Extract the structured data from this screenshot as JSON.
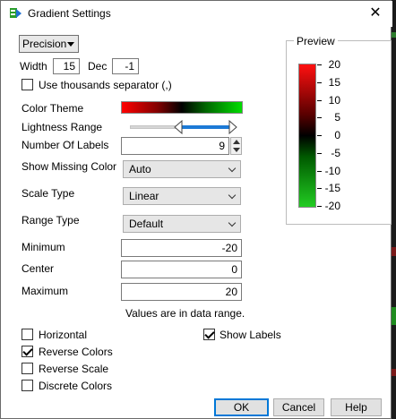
{
  "window": {
    "title": "Gradient Settings"
  },
  "format": {
    "precision_label": "Precision",
    "width_label": "Width",
    "width_value": "15",
    "dec_label": "Dec",
    "dec_value": "-1",
    "thousands_label": "Use thousands separator (,)",
    "thousands_checked": false
  },
  "settings": {
    "color_theme_label": "Color Theme",
    "lightness_range_label": "Lightness Range",
    "number_of_labels_label": "Number Of Labels",
    "number_of_labels_value": "9",
    "show_missing_color_label": "Show Missing Color",
    "show_missing_color_value": "Auto",
    "scale_type_label": "Scale Type",
    "scale_type_value": "Linear",
    "range_type_label": "Range Type",
    "range_type_value": "Default",
    "minimum_label": "Minimum",
    "minimum_value": "-20",
    "center_label": "Center",
    "center_value": "0",
    "maximum_label": "Maximum",
    "maximum_value": "20",
    "range_note": "Values are in data range."
  },
  "preview": {
    "label": "Preview",
    "tick_labels": [
      "20",
      "15",
      "10",
      "5",
      "0",
      "-5",
      "-10",
      "-15",
      "-20"
    ]
  },
  "options": {
    "horizontal_label": "Horizontal",
    "horizontal_checked": false,
    "reverse_colors_label": "Reverse Colors",
    "reverse_colors_checked": true,
    "reverse_scale_label": "Reverse Scale",
    "reverse_scale_checked": false,
    "discrete_colors_label": "Discrete Colors",
    "discrete_colors_checked": false,
    "show_labels_label": "Show Labels",
    "show_labels_checked": true
  },
  "buttons": {
    "ok": "OK",
    "cancel": "Cancel",
    "help": "Help"
  },
  "colors": {
    "gradient_high": "#ff1010",
    "gradient_mid": "#000000",
    "gradient_low": "#22cc22",
    "slider_fill": "#1c7ad6",
    "focus_border": "#0078d7"
  },
  "icons": {
    "title_icon": "gradient-settings-app-icon",
    "close_icon": "close-icon"
  }
}
